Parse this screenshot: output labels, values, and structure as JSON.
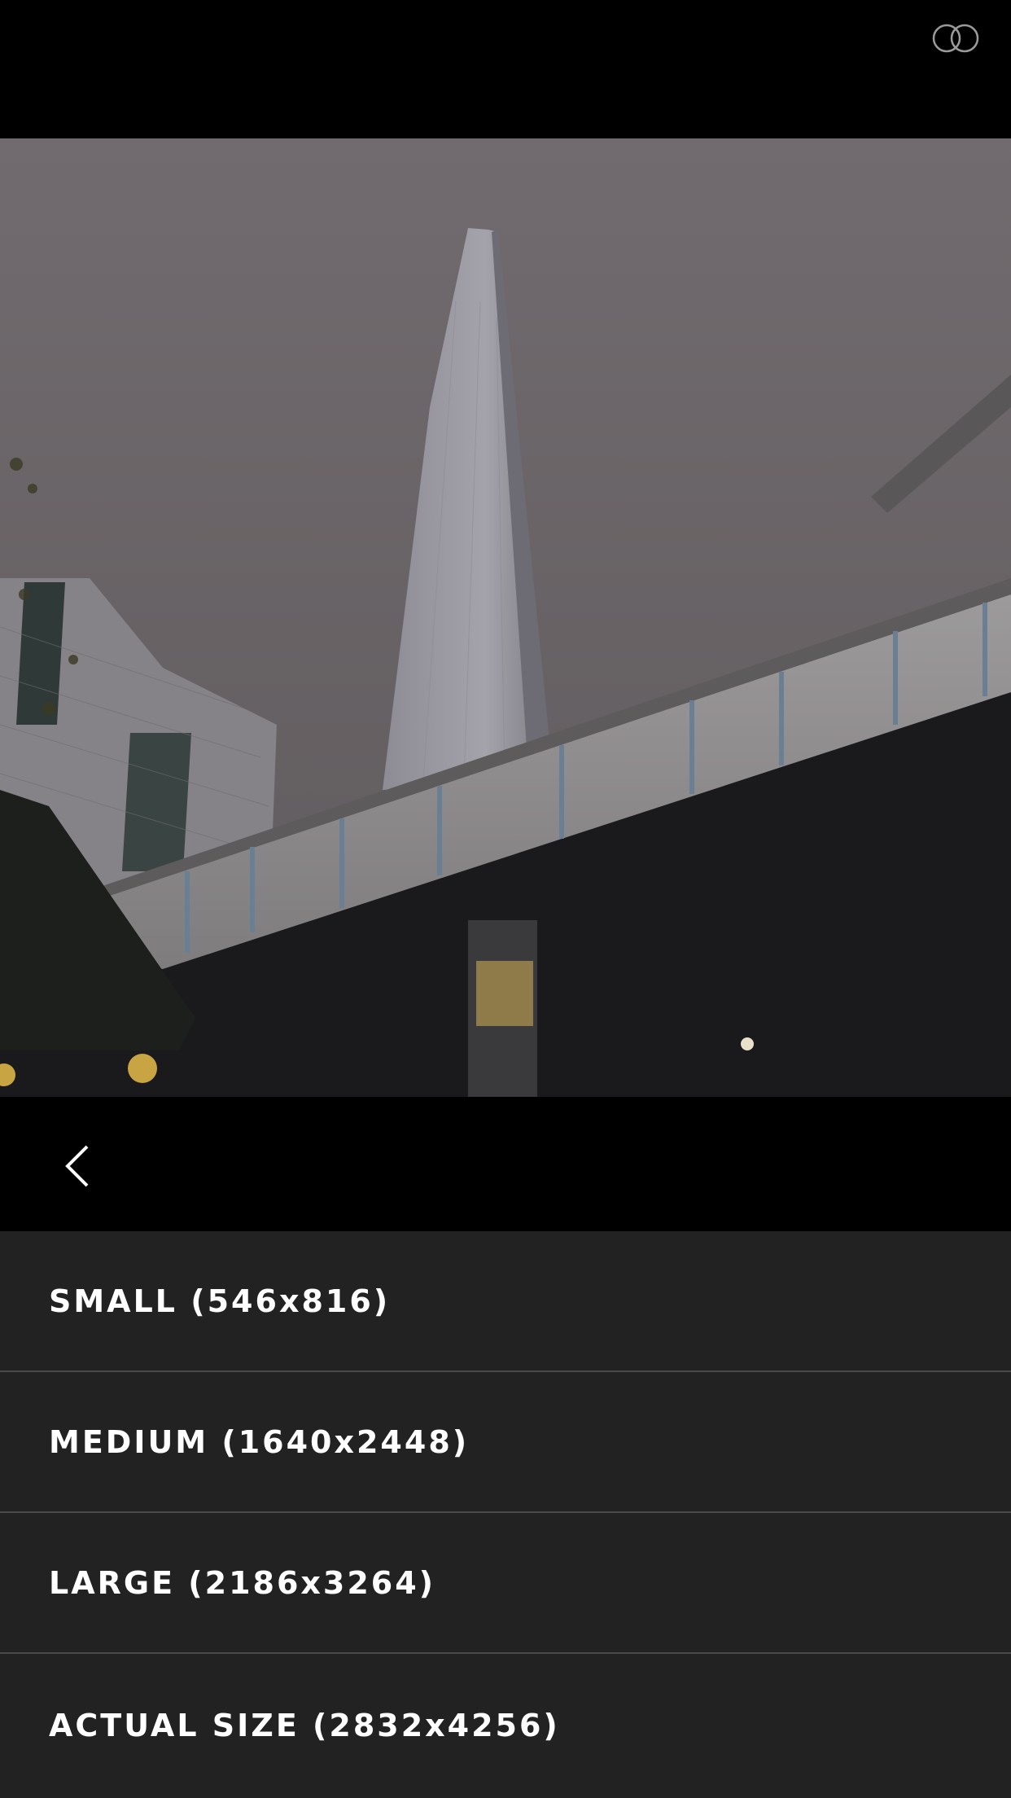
{
  "header": {
    "logo_icon": "rings-icon"
  },
  "photo": {
    "subject": "photo-viewer-image"
  },
  "nav": {
    "back_icon": "chevron-left-icon"
  },
  "size_options": [
    {
      "label": "SMALL (546x816)"
    },
    {
      "label": "MEDIUM (1640x2448)"
    },
    {
      "label": "LARGE (2186x3264)"
    },
    {
      "label": "ACTUAL SIZE (2832x4256)"
    }
  ],
  "colors": {
    "background": "#000000",
    "menu_background": "#222222",
    "divider": "#4a4a4a",
    "text": "#ffffff"
  }
}
